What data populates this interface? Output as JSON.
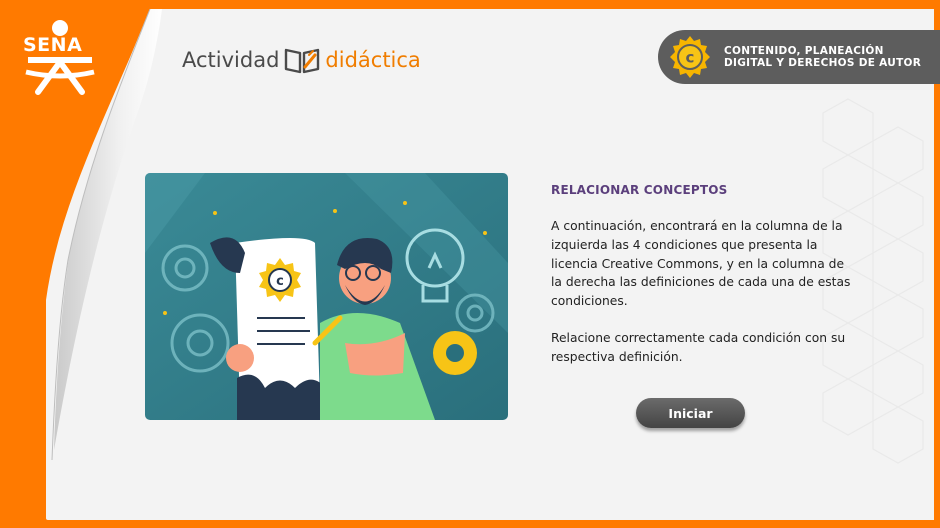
{
  "brand": {
    "org_logo_text": "SENA",
    "title_part1": "Actividad",
    "title_part2": "didáctica",
    "title_icon": "open-book-pencil-icon"
  },
  "topic_badge": {
    "icon": "copyright-seal-icon",
    "label": "CONTENIDO, PLANEACIÓN\nDIGITAL Y DERECHOS DE AUTOR"
  },
  "illustration": {
    "description_icon": "copyright-document-illustration"
  },
  "content": {
    "heading": "RELACIONAR CONCEPTOS",
    "paragraph1": "A continuación, encontrará en la columna de la izquierda las 4 condiciones que presenta la licencia Creative Commons, y en la columna de la derecha las definiciones de cada una de estas condiciones.",
    "paragraph2": "Relacione correctamente cada condición con su respectiva definición."
  },
  "actions": {
    "start_label": "Iniciar"
  },
  "colors": {
    "frame": "#ff7a00",
    "heading": "#5b3f7c",
    "accent_orange": "#f07d00",
    "button": "#555555"
  }
}
